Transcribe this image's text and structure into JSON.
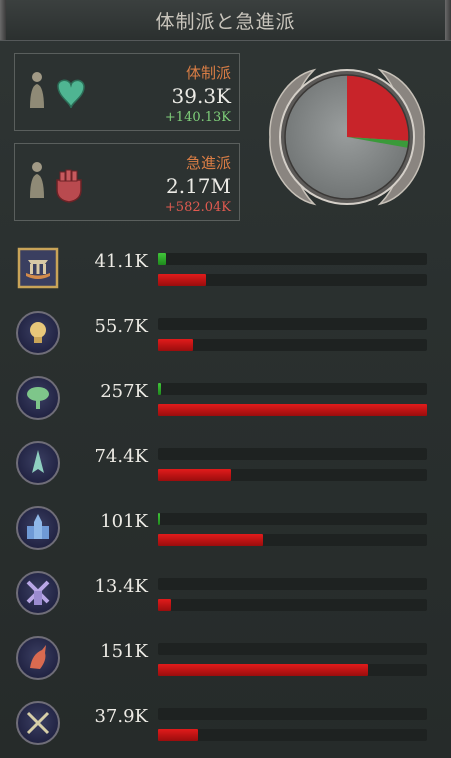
{
  "window": {
    "title": "体制派と急進派"
  },
  "loyalists": {
    "label": "体制派",
    "value": "39.3K",
    "delta": "+140.13K",
    "label_color": "#d97d45",
    "delta_color": "#7fcf7a",
    "icon": "heart-icon"
  },
  "radicals": {
    "label": "急進派",
    "value": "2.17M",
    "delta": "+582.04K",
    "label_color": "#d97d45",
    "delta_color": "#e05a50",
    "icon": "fist-icon"
  },
  "pie": {
    "loyalist_share": 0.018,
    "radical_share": 0.26,
    "neutral_share": 0.722,
    "colors": {
      "neutral": "#8a8e8e",
      "radical": "#c8242a",
      "loyalist": "#3a9a3a"
    }
  },
  "strata": [
    {
      "icon": "aristocrats-icon",
      "value": "41.1K",
      "loyalist_fill": 0.03,
      "radical_fill": 0.18
    },
    {
      "icon": "intelligentsia-icon",
      "value": "55.7K",
      "loyalist_fill": 0.0,
      "radical_fill": 0.13
    },
    {
      "icon": "farmers-icon",
      "value": "257K",
      "loyalist_fill": 0.01,
      "radical_fill": 1.0
    },
    {
      "icon": "clergy-icon",
      "value": "74.4K",
      "loyalist_fill": 0.0,
      "radical_fill": 0.27
    },
    {
      "icon": "church-icon",
      "value": "101K",
      "loyalist_fill": 0.008,
      "radical_fill": 0.39
    },
    {
      "icon": "windmill-icon",
      "value": "13.4K",
      "loyalist_fill": 0.0,
      "radical_fill": 0.05
    },
    {
      "icon": "industrialists-icon",
      "value": "151K",
      "loyalist_fill": 0.0,
      "radical_fill": 0.78
    },
    {
      "icon": "soldiers-icon",
      "value": "37.9K",
      "loyalist_fill": 0.0,
      "radical_fill": 0.15
    }
  ]
}
